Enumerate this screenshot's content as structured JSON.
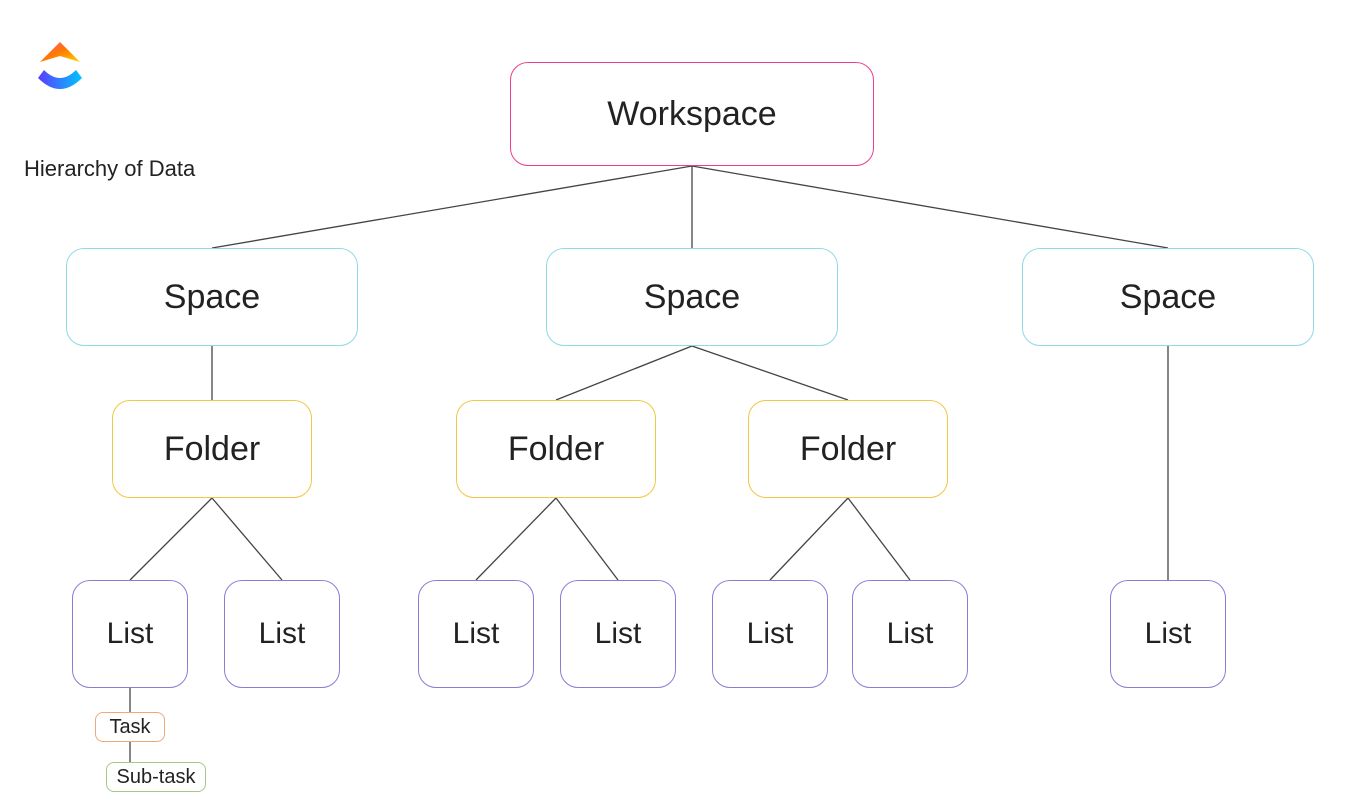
{
  "caption": "Hierarchy of Data",
  "nodes": {
    "workspace": "Workspace",
    "space1": "Space",
    "space2": "Space",
    "space3": "Space",
    "folder1": "Folder",
    "folder2": "Folder",
    "folder3": "Folder",
    "list1": "List",
    "list2": "List",
    "list3": "List",
    "list4": "List",
    "list5": "List",
    "list6": "List",
    "list7": "List",
    "task": "Task",
    "subtask": "Sub-task"
  },
  "colors": {
    "workspace": "#ec3e8c",
    "space": "#8fd9e8",
    "folder": "#f2c744",
    "list": "#8d7bd6",
    "task": "#f0a87a",
    "subtask": "#a3c985"
  },
  "chart_data": {
    "type": "tree-hierarchy",
    "title": "Hierarchy of Data",
    "root": {
      "label": "Workspace",
      "level": "workspace",
      "children": [
        {
          "label": "Space",
          "level": "space",
          "children": [
            {
              "label": "Folder",
              "level": "folder",
              "children": [
                {
                  "label": "List",
                  "level": "list",
                  "children": [
                    {
                      "label": "Task",
                      "level": "task",
                      "children": [
                        {
                          "label": "Sub-task",
                          "level": "subtask"
                        }
                      ]
                    }
                  ]
                },
                {
                  "label": "List",
                  "level": "list"
                }
              ]
            }
          ]
        },
        {
          "label": "Space",
          "level": "space",
          "children": [
            {
              "label": "Folder",
              "level": "folder",
              "children": [
                {
                  "label": "List",
                  "level": "list"
                },
                {
                  "label": "List",
                  "level": "list"
                }
              ]
            },
            {
              "label": "Folder",
              "level": "folder",
              "children": [
                {
                  "label": "List",
                  "level": "list"
                },
                {
                  "label": "List",
                  "level": "list"
                }
              ]
            }
          ]
        },
        {
          "label": "Space",
          "level": "space",
          "children": [
            {
              "label": "List",
              "level": "list"
            }
          ]
        }
      ]
    },
    "level_colors": {
      "workspace": "#ec3e8c",
      "space": "#8fd9e8",
      "folder": "#f2c744",
      "list": "#8d7bd6",
      "task": "#f0a87a",
      "subtask": "#a3c985"
    }
  }
}
